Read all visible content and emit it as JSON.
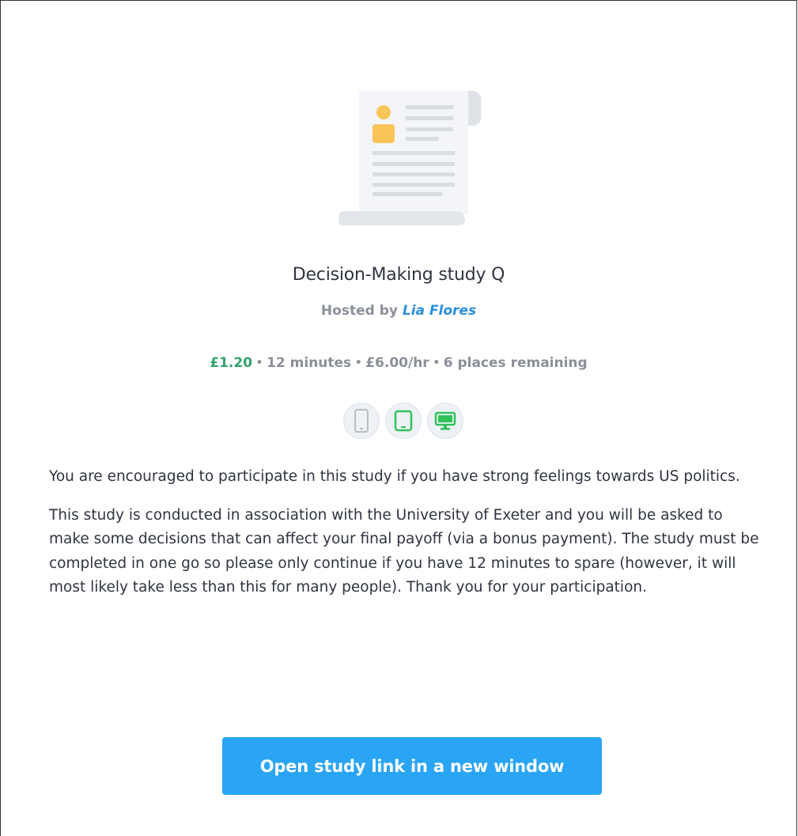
{
  "study": {
    "title": "Decision-Making study Q",
    "hosted_prefix": "Hosted by",
    "host_name": "Lia Flores",
    "reward": "£1.20",
    "sep": "•",
    "duration": "12 minutes",
    "hourly_rate": "£6.00/hr",
    "places": "6 places remaining"
  },
  "devices": [
    {
      "name": "mobile-icon",
      "allowed": false
    },
    {
      "name": "tablet-icon",
      "allowed": true
    },
    {
      "name": "desktop-icon",
      "allowed": true
    }
  ],
  "description": {
    "paragraph_1": "You are encouraged to participate in this study if you have strong feelings towards US politics.",
    "paragraph_2": "This study is conducted in association with the University of Exeter and you will be asked to make some decisions that can affect your final payoff (via a bonus payment). The study must be completed in one go so please only continue if you have 12 minutes to spare (however, it will most likely take less than this for many people). Thank you for your participation."
  },
  "cta": {
    "label": "Open study link in a new window"
  },
  "colors": {
    "accent": "#2aa4f4",
    "reward": "#32a36b",
    "host_link": "#2b8fe0",
    "device_allowed": "#2fc25b",
    "device_disallowed": "#b8bdc4"
  }
}
